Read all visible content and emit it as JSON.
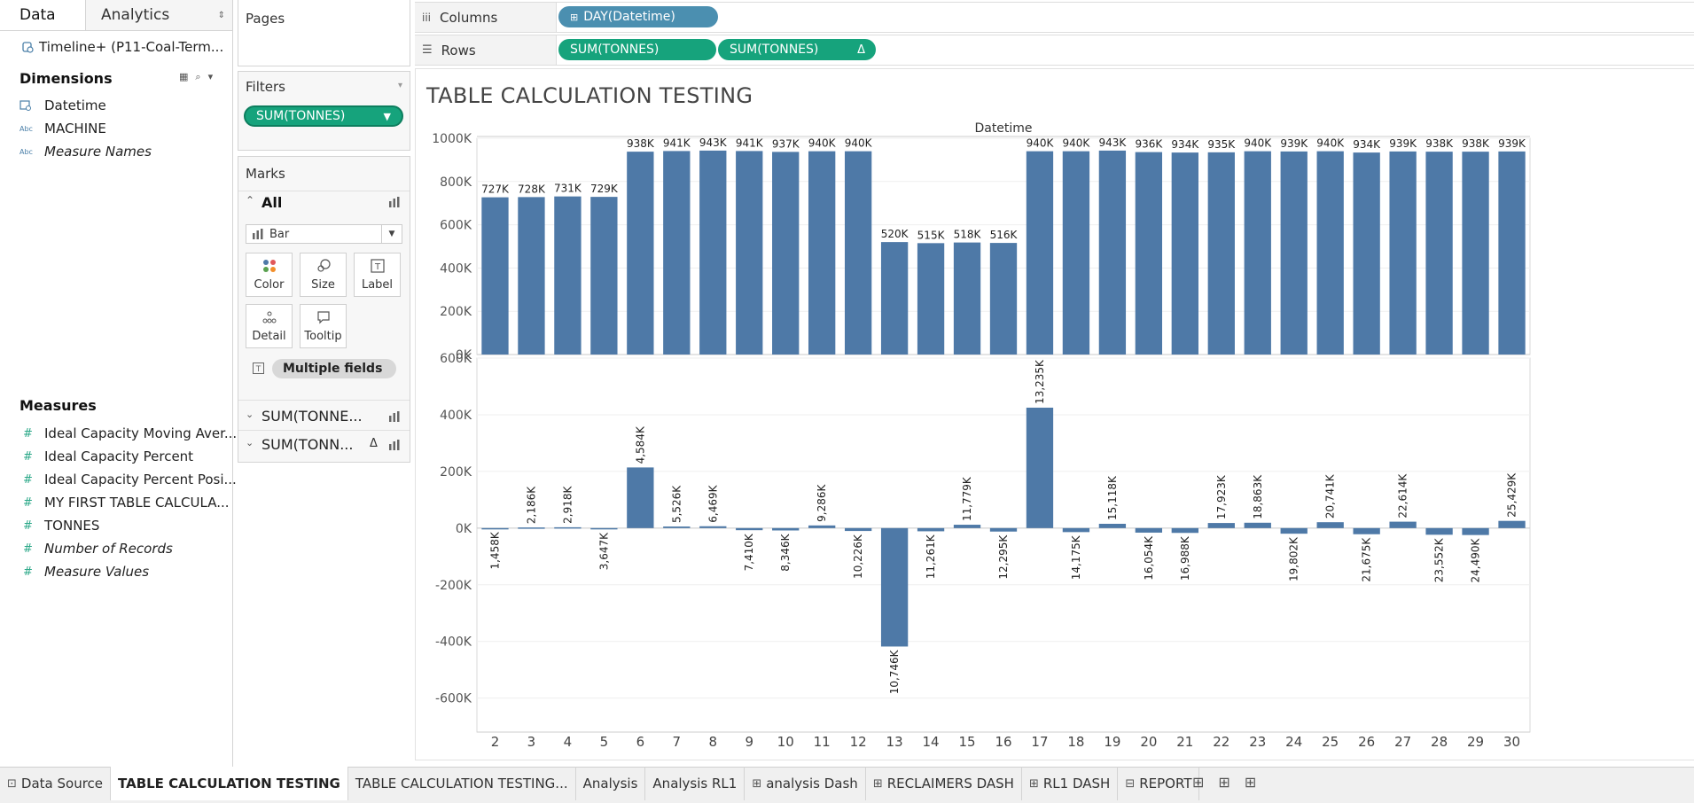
{
  "left": {
    "tabs": {
      "data": "Data",
      "analytics": "Analytics"
    },
    "datasource": "Timeline+ (P11-Coal-Term...",
    "dimensions_title": "Dimensions",
    "dimensions": [
      {
        "icon": "calendar-icon",
        "label": "Datetime",
        "italic": false
      },
      {
        "icon": "abc-icon",
        "label": "MACHINE",
        "italic": false
      },
      {
        "icon": "abc-icon",
        "label": "Measure Names",
        "italic": true
      }
    ],
    "measures_title": "Measures",
    "measures": [
      {
        "label": "Ideal Capacity Moving Aver...",
        "italic": false
      },
      {
        "label": "Ideal Capacity Percent",
        "italic": false
      },
      {
        "label": "Ideal Capacity Percent Posi...",
        "italic": false
      },
      {
        "label": "MY FIRST TABLE CALCULA...",
        "italic": false
      },
      {
        "label": "TONNES",
        "italic": false
      },
      {
        "label": "Number of Records",
        "italic": true
      },
      {
        "label": "Measure Values",
        "italic": true
      }
    ]
  },
  "cards": {
    "pages": "Pages",
    "filters": "Filters",
    "filter_pill": "SUM(TONNES)",
    "marks": "Marks",
    "marks_all": "All",
    "mark_type": "Bar",
    "buttons": {
      "color": "Color",
      "size": "Size",
      "label": "Label",
      "detail": "Detail",
      "tooltip": "Tooltip"
    },
    "multiple_fields": "Multiple fields",
    "sub1": "SUM(TONNE...",
    "sub2": "SUM(TONN...",
    "delta": "Δ"
  },
  "shelves": {
    "columns_label": "Columns",
    "rows_label": "Rows",
    "columns_pill": "DAY(Datetime)",
    "rows_pill1": "SUM(TONNES)",
    "rows_pill2": "SUM(TONNES)",
    "delta": "Δ"
  },
  "viz": {
    "title": "TABLE CALCULATION TESTING",
    "header": "Datetime"
  },
  "chart_data": [
    {
      "type": "bar",
      "categories": [
        "2",
        "3",
        "4",
        "5",
        "6",
        "7",
        "8",
        "9",
        "10",
        "11",
        "12",
        "13",
        "14",
        "15",
        "16",
        "17",
        "18",
        "19",
        "20",
        "21",
        "22",
        "23",
        "24",
        "25",
        "26",
        "27",
        "28",
        "29",
        "30"
      ],
      "values": [
        727000,
        728000,
        731000,
        729000,
        938000,
        941000,
        943000,
        941000,
        937000,
        940000,
        940000,
        520000,
        515000,
        518000,
        516000,
        940000,
        940000,
        943000,
        936000,
        934000,
        935000,
        940000,
        939000,
        940000,
        934000,
        939000,
        938000,
        938000,
        939000
      ],
      "data_labels": [
        "727K",
        "728K",
        "731K",
        "729K",
        "938K",
        "941K",
        "943K",
        "941K",
        "937K",
        "940K",
        "940K",
        "520K",
        "515K",
        "518K",
        "516K",
        "940K",
        "940K",
        "943K",
        "936K",
        "934K",
        "935K",
        "940K",
        "939K",
        "940K",
        "934K",
        "939K",
        "938K",
        "938K",
        "939K"
      ],
      "yticks": [
        "0K",
        "200K",
        "400K",
        "600K",
        "800K",
        "1000K"
      ],
      "ytick_values": [
        0,
        200000,
        400000,
        600000,
        800000,
        1000000
      ],
      "ylim": [
        0,
        1000000
      ],
      "color": "#4e79a7"
    },
    {
      "type": "bar",
      "categories": [
        "2",
        "3",
        "4",
        "5",
        "6",
        "7",
        "8",
        "9",
        "10",
        "11",
        "12",
        "13",
        "14",
        "15",
        "16",
        "17",
        "18",
        "19",
        "20",
        "21",
        "22",
        "23",
        "24",
        "25",
        "26",
        "27",
        "28",
        "29",
        "30"
      ],
      "values": [
        -1458,
        2186,
        2918,
        -3647,
        214000,
        5526,
        6469,
        -7410,
        -8346,
        9286,
        -10226,
        -418000,
        -11261,
        11779,
        -12295,
        425000,
        -14175,
        15118,
        -16054,
        -16988,
        17923,
        18863,
        -19802,
        20741,
        -21675,
        22614,
        -23552,
        -24490,
        25429
      ],
      "data_labels": [
        "1,458K",
        "2,186K",
        "2,918K",
        "3,647K",
        "4,584K",
        "5,526K",
        "6,469K",
        "7,410K",
        "8,346K",
        "9,286K",
        "10,226K",
        "10,746K",
        "11,261K",
        "11,779K",
        "12,295K",
        "13,235K",
        "14,175K",
        "15,118K",
        "16,054K",
        "16,988K",
        "17,923K",
        "18,863K",
        "19,802K",
        "20,741K",
        "21,675K",
        "22,614K",
        "23,552K",
        "24,490K",
        "25,429K"
      ],
      "yticks": [
        "-600K",
        "-400K",
        "-200K",
        "0K",
        "200K",
        "400K",
        "600K"
      ],
      "ytick_values": [
        -600000,
        -400000,
        -200000,
        0,
        200000,
        400000,
        600000
      ],
      "ylim": [
        -720000,
        600000
      ],
      "color": "#4e79a7"
    }
  ],
  "bottom_tabs": [
    {
      "icon": "datasource-icon",
      "label": "Data Source",
      "active": false
    },
    {
      "icon": "",
      "label": "TABLE CALCULATION TESTING",
      "active": true
    },
    {
      "icon": "",
      "label": "TABLE CALCULATION TESTING...",
      "active": false
    },
    {
      "icon": "",
      "label": "Analysis",
      "active": false
    },
    {
      "icon": "",
      "label": "Analysis RL1",
      "active": false
    },
    {
      "icon": "dashboard-icon",
      "label": "analysis Dash",
      "active": false
    },
    {
      "icon": "dashboard-icon",
      "label": "RECLAIMERS DASH",
      "active": false
    },
    {
      "icon": "dashboard-icon",
      "label": "RL1 DASH",
      "active": false
    },
    {
      "icon": "story-icon",
      "label": "REPORT",
      "active": false
    }
  ]
}
